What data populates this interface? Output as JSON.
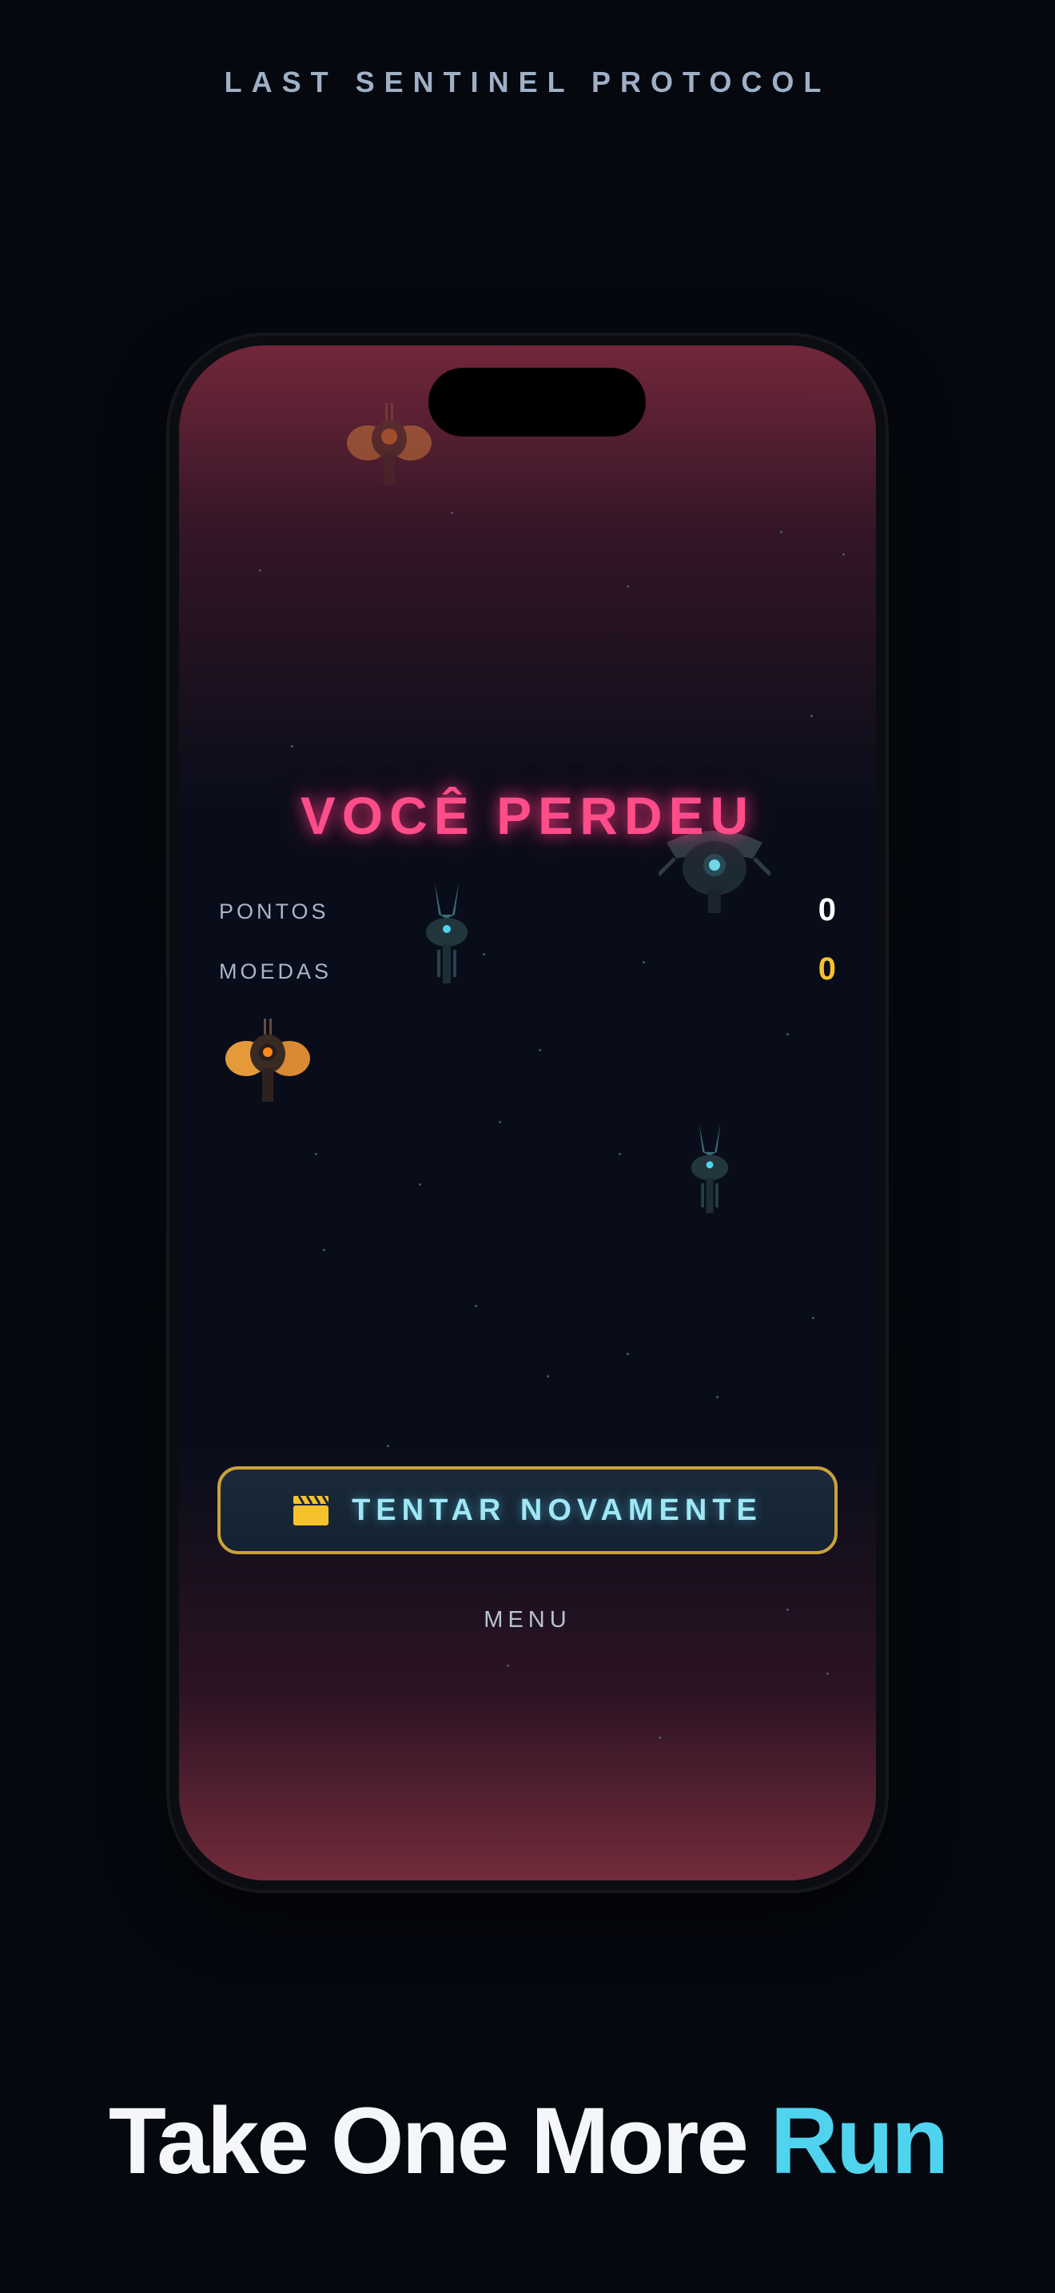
{
  "page": {
    "title": "LAST SENTINEL PROTOCOL"
  },
  "game": {
    "result_title": "VOCÊ PERDEU",
    "stats": [
      {
        "label": "PONTOS",
        "value": "0",
        "color": "#ffffff"
      },
      {
        "label": "MOEDAS",
        "value": "0",
        "color": "#f5c22e"
      }
    ],
    "retry_button": {
      "label": "TENTAR NOVAMENTE",
      "icon": "clapperboard-icon",
      "icon_color": "#f5c22e"
    },
    "menu_link": "MENU"
  },
  "tagline": {
    "text": "Take One More",
    "accent": "Run",
    "accent_color": "#4fd3ee"
  },
  "colors": {
    "lose_title": "#ff4d8a",
    "button_border": "#c9a23a",
    "background": "#05080f"
  }
}
